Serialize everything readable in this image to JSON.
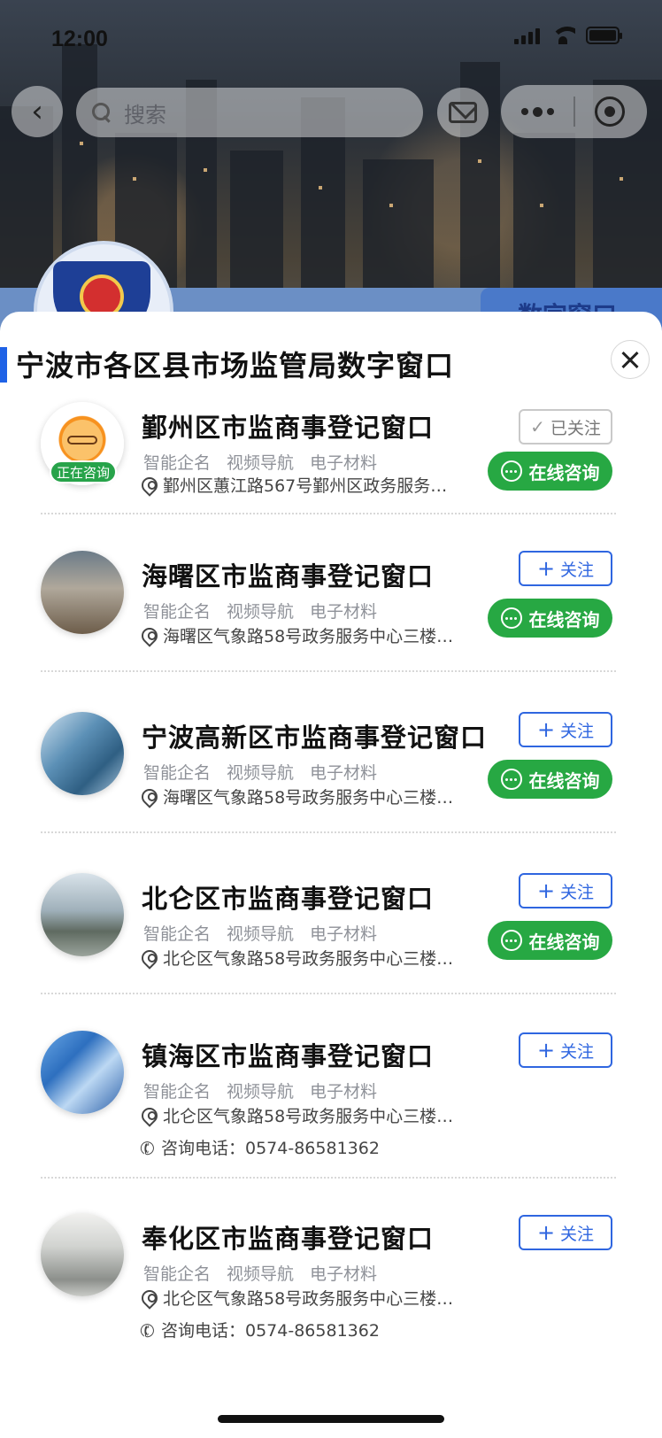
{
  "status_bar": {
    "time": "12:00"
  },
  "nav": {
    "search_placeholder": "搜索"
  },
  "background": {
    "tag_text": "数字窗口"
  },
  "sheet": {
    "title": "宁波市各区县市场监管局数字窗口",
    "items": [
      {
        "name": "鄞州区市监商事登记窗口",
        "tags": [
          "智能企名",
          "视频导航",
          "电子材料"
        ],
        "address": "鄞州区蕙江路567号鄞州区政务服务…",
        "phone": "",
        "follow_label": "已关注",
        "followed": true,
        "live_badge": "正在咨询",
        "consult_label": "在线咨询"
      },
      {
        "name": "海曙区市监商事登记窗口",
        "tags": [
          "智能企名",
          "视频导航",
          "电子材料"
        ],
        "address": "海曙区气象路58号政务服务中心三楼…",
        "phone": "",
        "follow_label": "关注",
        "followed": false,
        "consult_label": "在线咨询"
      },
      {
        "name": "宁波高新区市监商事登记窗口",
        "tags": [
          "智能企名",
          "视频导航",
          "电子材料"
        ],
        "address": "海曙区气象路58号政务服务中心三楼…",
        "phone": "",
        "follow_label": "关注",
        "followed": false,
        "consult_label": "在线咨询"
      },
      {
        "name": "北仑区市监商事登记窗口",
        "tags": [
          "智能企名",
          "视频导航",
          "电子材料"
        ],
        "address": "北仑区气象路58号政务服务中心三楼…",
        "phone": "",
        "follow_label": "关注",
        "followed": false,
        "consult_label": "在线咨询"
      },
      {
        "name": "镇海区市监商事登记窗口",
        "tags": [
          "智能企名",
          "视频导航",
          "电子材料"
        ],
        "address": "北仑区气象路58号政务服务中心三楼…",
        "phone": "咨询电话：0574-86581362",
        "follow_label": "关注",
        "followed": false
      },
      {
        "name": "奉化区市监商事登记窗口",
        "tags": [
          "智能企名",
          "视频导航",
          "电子材料"
        ],
        "address": "北仑区气象路58号政务服务中心三楼…",
        "phone": "咨询电话：0574-86581362",
        "follow_label": "关注",
        "followed": false
      }
    ]
  },
  "colors": {
    "accent_blue": "#1f62e6",
    "follow_blue": "#2f66e0",
    "consult_green": "#27a843"
  }
}
